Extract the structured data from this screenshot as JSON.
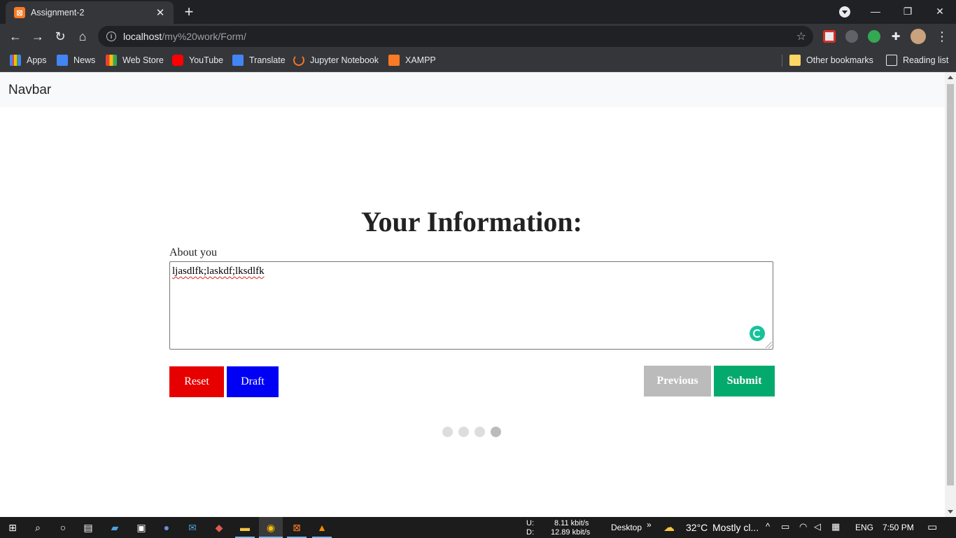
{
  "browser": {
    "tab_title": "Assignment-2",
    "tab_favicon": "xampp-icon",
    "new_tab_symbol": "+",
    "url_host": "localhost",
    "url_path": "/my%20work/Form/",
    "bookmarks": [
      {
        "label": "Apps",
        "icon": "apps-grid-icon",
        "color": "#4285f4"
      },
      {
        "label": "News",
        "icon": "google-news-icon",
        "color": "#4285f4"
      },
      {
        "label": "Web Store",
        "icon": "web-store-icon",
        "color": "#ea4335"
      },
      {
        "label": "YouTube",
        "icon": "youtube-icon",
        "color": "#ff0000"
      },
      {
        "label": "Translate",
        "icon": "translate-icon",
        "color": "#4285f4"
      },
      {
        "label": "Jupyter Notebook",
        "icon": "jupyter-icon",
        "color": "#f37626"
      },
      {
        "label": "XAMPP",
        "icon": "xampp-icon",
        "color": "#fb7a24"
      }
    ],
    "other_bookmarks": "Other bookmarks",
    "reading_list": "Reading list"
  },
  "page": {
    "navbar_brand": "Navbar",
    "form_title": "Your Information:",
    "field_label": "About you",
    "field_value": "ljasdlfk;laskdf;lksdlfk",
    "buttons": {
      "reset": "Reset",
      "draft": "Draft",
      "previous": "Previous",
      "submit": "Submit"
    },
    "steps_total": 4,
    "steps_active": 4,
    "colors": {
      "reset": "#e60000",
      "draft": "#0000f5",
      "previous": "#bbbbbb",
      "submit": "#04aa6d"
    }
  },
  "taskbar": {
    "net_up_label": "U:",
    "net_down_label": "D:",
    "net_up": "8.11 kbit/s",
    "net_down": "12.89 kbit/s",
    "desktop": "Desktop",
    "weather_temp": "32°C",
    "weather_text": "Mostly cl...",
    "language": "ENG",
    "time": "7:50 PM"
  }
}
